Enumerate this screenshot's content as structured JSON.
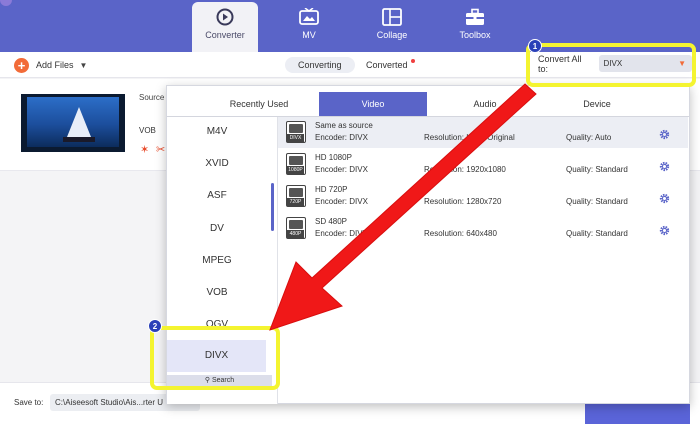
{
  "nav": {
    "tabs": [
      {
        "label": "Converter",
        "icon": "converter-icon",
        "active": true
      },
      {
        "label": "MV",
        "icon": "tv-icon"
      },
      {
        "label": "Collage",
        "icon": "collage-icon"
      },
      {
        "label": "Toolbox",
        "icon": "toolbox-icon"
      }
    ]
  },
  "toolbar": {
    "add_files": "Add Files",
    "converting": "Converting",
    "converted": "Converted",
    "convert_all_label": "Convert All to:",
    "convert_all_value": "DIVX"
  },
  "badges": {
    "one": "1",
    "two": "2"
  },
  "file": {
    "source_label": "Source",
    "format": "VOB"
  },
  "bottom": {
    "save_to": "Save to:",
    "save_path": "C:\\Aiseesoft Studio\\Ais...rter U"
  },
  "panel": {
    "tabs": [
      "Recently Used",
      "Video",
      "Audio",
      "Device"
    ],
    "active_tab": "Video",
    "formats": [
      "M4V",
      "XVID",
      "ASF",
      "DV",
      "MPEG",
      "VOB",
      "OGV",
      "DIVX"
    ],
    "selected_format": "DIVX",
    "search": "Search",
    "presets": [
      {
        "name": "Same as source",
        "encoder": "Encoder: DIVX",
        "resolution": "Resolution: Keep Original",
        "quality": "Quality: Auto",
        "tag": "DIVX"
      },
      {
        "name": "HD 1080P",
        "encoder": "Encoder: DIVX",
        "resolution": "Resolution: 1920x1080",
        "quality": "Quality: Standard",
        "tag": "1080P"
      },
      {
        "name": "HD 720P",
        "encoder": "Encoder: DIVX",
        "resolution": "Resolution: 1280x720",
        "quality": "Quality: Standard",
        "tag": "720P"
      },
      {
        "name": "SD 480P",
        "encoder": "Encoder: DIVX",
        "resolution": "Resolution: 640x480",
        "quality": "Quality: Standard",
        "tag": "480P"
      }
    ]
  },
  "colors": {
    "accent": "#5a64c8",
    "highlight": "#f4f430",
    "arrow": "#f01818",
    "orange": "#f26b38"
  }
}
